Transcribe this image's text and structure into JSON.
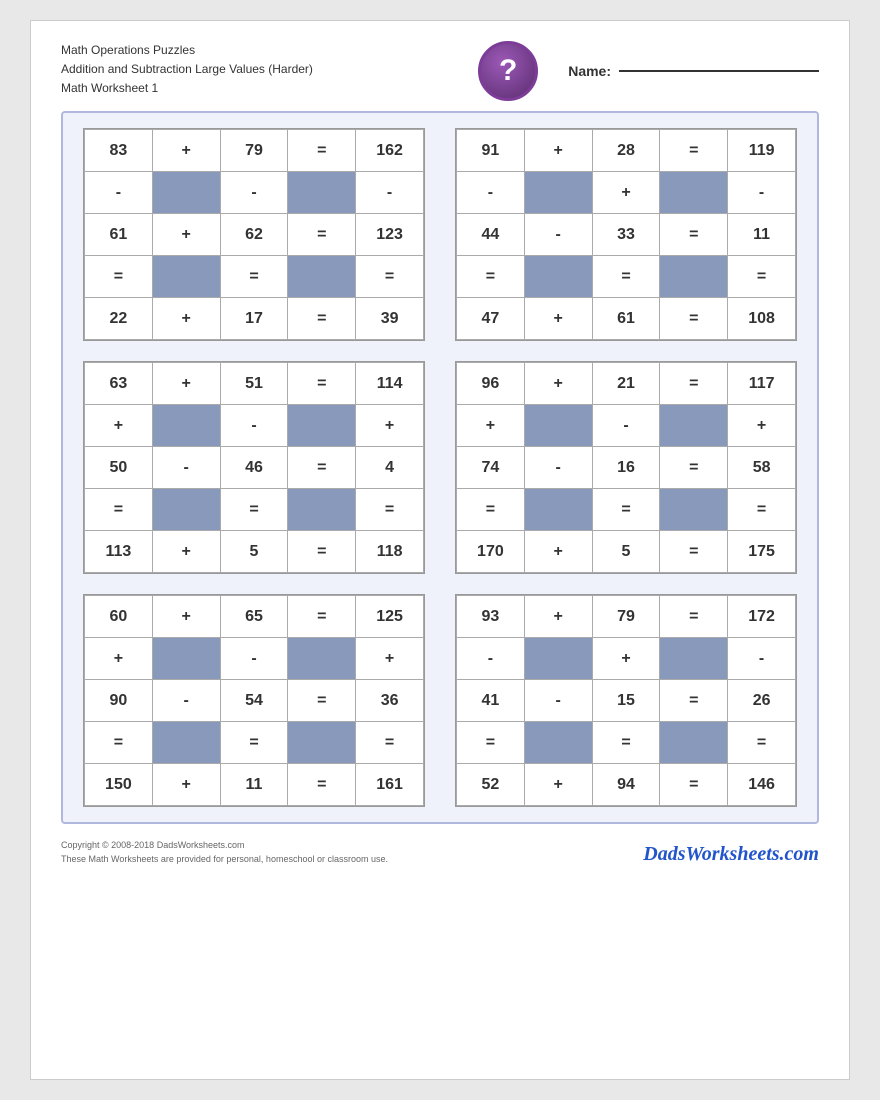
{
  "header": {
    "title1": "Math Operations Puzzles",
    "title2": "Addition and Subtraction Large Values (Harder)",
    "title3": "Math Worksheet 1",
    "name_label": "Name:",
    "question_mark": "?"
  },
  "footer": {
    "copyright": "Copyright © 2008-2018 DadsWorksheets.com",
    "disclaimer": "These Math Worksheets are provided for personal, homeschool or classroom use.",
    "brand": "DadsWorksheets.com"
  },
  "puzzles": [
    {
      "id": "puzzle1",
      "rows": [
        [
          "83",
          "+",
          "79",
          "=",
          "162"
        ],
        [
          "-",
          "gray",
          "-",
          "gray",
          "-"
        ],
        [
          "61",
          "+",
          "62",
          "=",
          "123"
        ],
        [
          "=",
          "gray",
          "=",
          "gray",
          "="
        ],
        [
          "22",
          "+",
          "17",
          "=",
          "39"
        ]
      ],
      "blue_cells": []
    },
    {
      "id": "puzzle2",
      "rows": [
        [
          "91",
          "+",
          "28",
          "=",
          "119"
        ],
        [
          "-",
          "gray",
          "+",
          "gray",
          "-"
        ],
        [
          "44",
          "-",
          "33",
          "=",
          "11"
        ],
        [
          "=",
          "gray",
          "=",
          "gray",
          "="
        ],
        [
          "47",
          "+",
          "61",
          "=",
          "108"
        ]
      ],
      "blue_cells": [
        "5,4"
      ]
    },
    {
      "id": "puzzle3",
      "rows": [
        [
          "63",
          "+",
          "51",
          "=",
          "114"
        ],
        [
          "+",
          "gray",
          "-",
          "gray",
          "+"
        ],
        [
          "50",
          "-",
          "46",
          "=",
          "4"
        ],
        [
          "=",
          "gray",
          "=",
          "gray",
          "="
        ],
        [
          "113",
          "+",
          "5",
          "=",
          "118"
        ]
      ],
      "blue_cells": [
        "2,2"
      ]
    },
    {
      "id": "puzzle4",
      "rows": [
        [
          "96",
          "+",
          "21",
          "=",
          "117"
        ],
        [
          "+",
          "gray",
          "-",
          "gray",
          "+"
        ],
        [
          "74",
          "-",
          "16",
          "=",
          "58"
        ],
        [
          "=",
          "gray",
          "=",
          "gray",
          "="
        ],
        [
          "170",
          "+",
          "5",
          "=",
          "175"
        ]
      ],
      "blue_cells": [
        "3,2"
      ]
    },
    {
      "id": "puzzle5",
      "rows": [
        [
          "60",
          "+",
          "65",
          "=",
          "125"
        ],
        [
          "+",
          "gray",
          "-",
          "gray",
          "+"
        ],
        [
          "90",
          "-",
          "54",
          "=",
          "36"
        ],
        [
          "=",
          "gray",
          "=",
          "gray",
          "="
        ],
        [
          "150",
          "+",
          "11",
          "=",
          "161"
        ]
      ],
      "blue_cells": [
        "5,2"
      ]
    },
    {
      "id": "puzzle6",
      "rows": [
        [
          "93",
          "+",
          "79",
          "=",
          "172"
        ],
        [
          "-",
          "gray",
          "+",
          "gray",
          "-"
        ],
        [
          "41",
          "-",
          "15",
          "=",
          "26"
        ],
        [
          "=",
          "gray",
          "=",
          "gray",
          "="
        ],
        [
          "52",
          "+",
          "94",
          "=",
          "146"
        ]
      ],
      "blue_cells": []
    }
  ]
}
